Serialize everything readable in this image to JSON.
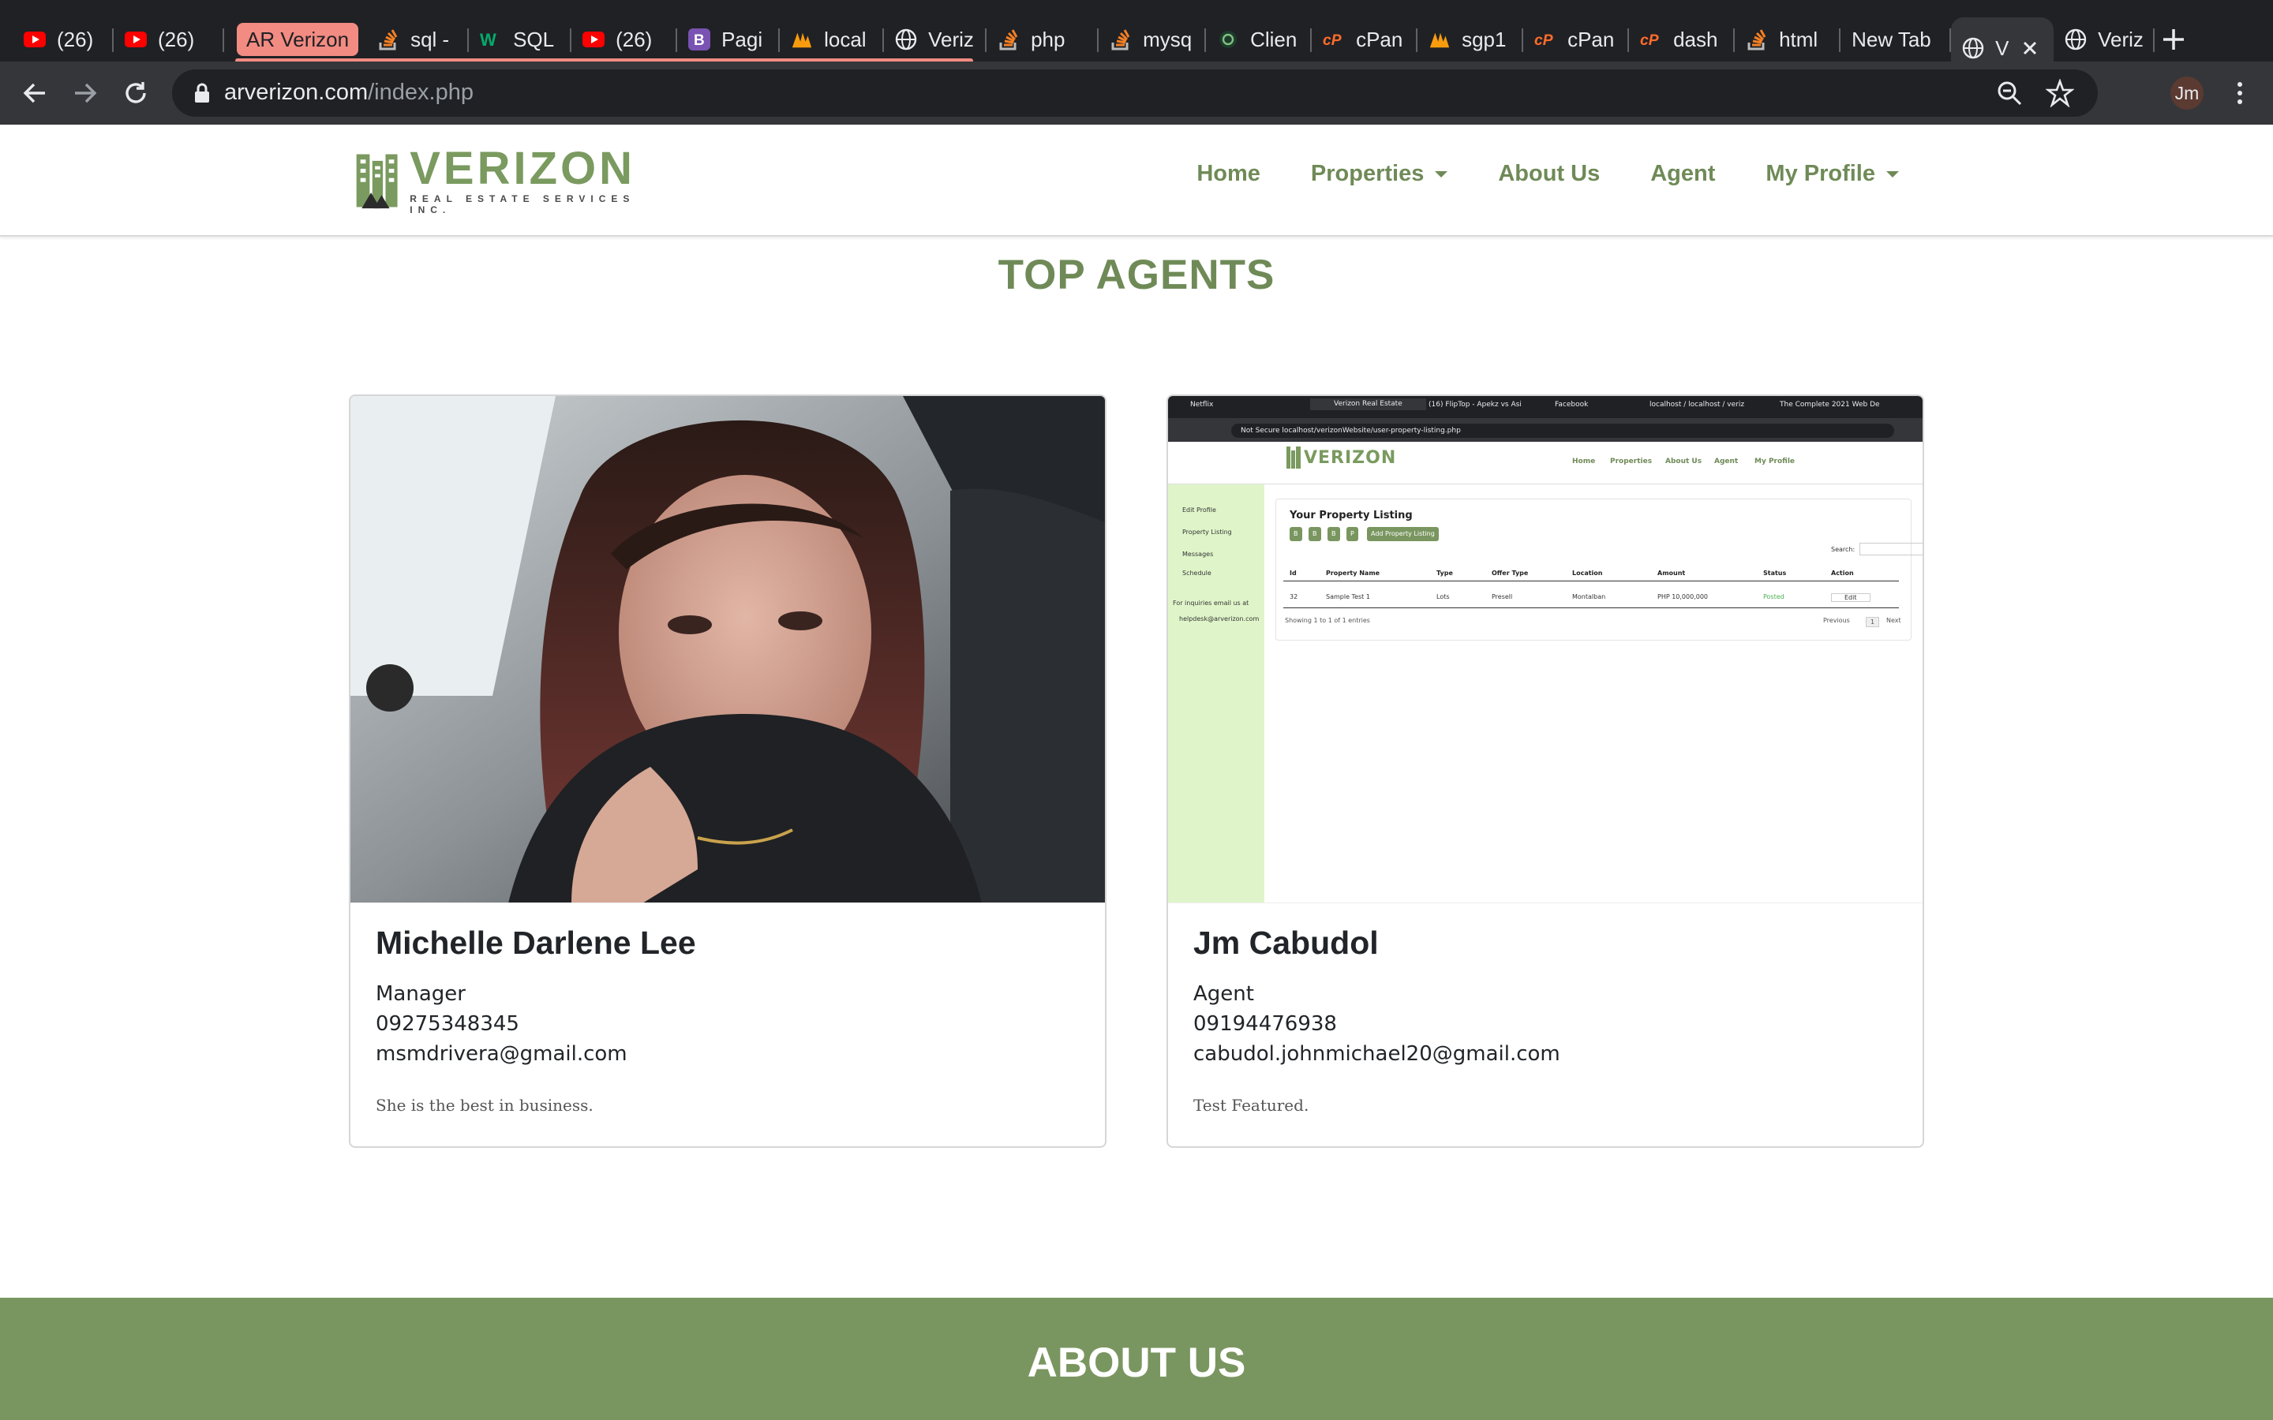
{
  "browser": {
    "tabs": [
      {
        "icon": "youtube-icon",
        "label": "(26)"
      },
      {
        "icon": "youtube-icon",
        "label": "(26)"
      },
      {
        "icon": "stackoverflow-icon",
        "label": "sql -"
      },
      {
        "icon": "w3schools-icon",
        "label": "SQL"
      },
      {
        "icon": "youtube-icon",
        "label": "(26)"
      },
      {
        "icon": "bootstrap-icon",
        "label": "Pagi"
      },
      {
        "icon": "phpmyadmin-icon",
        "label": "local"
      },
      {
        "icon": "globe-icon",
        "label": "Veriz"
      },
      {
        "icon": "stackoverflow-icon",
        "label": "php"
      },
      {
        "icon": "stackoverflow-icon",
        "label": "mysq"
      },
      {
        "icon": "client-icon",
        "label": "Clien"
      },
      {
        "icon": "cpanel-icon",
        "label": "cPan"
      },
      {
        "icon": "phpmyadmin-icon",
        "label": "sgp1"
      },
      {
        "icon": "cpanel-icon",
        "label": "cPan"
      },
      {
        "icon": "cpanel-icon",
        "label": "dash"
      },
      {
        "icon": "stackoverflow-icon",
        "label": "html"
      },
      {
        "icon": "",
        "label": "New Tab"
      },
      {
        "icon": "globe-icon",
        "label": "V"
      },
      {
        "icon": "globe-icon",
        "label": "Veriz"
      }
    ],
    "tab_group_label": "AR Verizon",
    "url_domain": "arverizon.com",
    "url_path": "/index.php",
    "profile_initials": "Jm",
    "colors": {
      "tab_group": "#f28b82",
      "chrome_dark": "#202124",
      "chrome_toolbar": "#35363a"
    }
  },
  "site": {
    "logo": {
      "word": "VERIZON",
      "sub": "REAL ESTATE SERVICES INC."
    },
    "nav": [
      {
        "label": "Home",
        "dropdown": false
      },
      {
        "label": "Properties",
        "dropdown": true
      },
      {
        "label": "About Us",
        "dropdown": false
      },
      {
        "label": "Agent",
        "dropdown": false
      },
      {
        "label": "My Profile",
        "dropdown": true
      }
    ],
    "colors": {
      "brand_green": "#6f8a57",
      "band_green": "#7a9660"
    }
  },
  "top_agents": {
    "title": "TOP AGENTS",
    "agents": [
      {
        "name": "Michelle Darlene Lee",
        "role": "Manager",
        "phone": "09275348345",
        "email": "msmdrivera@gmail.com",
        "description": "She is the best in business."
      },
      {
        "name": "Jm Cabudol",
        "role": "Agent",
        "phone": "09194476938",
        "email": "cabudol.johnmichael20@gmail.com",
        "description": "Test Featured."
      }
    ]
  },
  "about": {
    "title": "ABOUT US"
  },
  "agent2_screenshot": {
    "tabs": [
      "Netflix",
      "Verizon Real Estate",
      "(16) FlipTop - Apekz vs Asi",
      "Facebook",
      "localhost / localhost / veriz",
      "The Complete 2021 Web De"
    ],
    "url": "Not Secure  localhost/verizonWebsite/user-property-listing.php",
    "nav": [
      "Home",
      "Properties",
      "About Us",
      "Agent",
      "My Profile"
    ],
    "sidebar": [
      "Edit Profile",
      "Property Listing",
      "Messages",
      "Schedule"
    ],
    "inquiries": "For inquiries email us at",
    "inquiries_email": "helpdesk@arverizon.com",
    "panel_title": "Your Property Listing",
    "add_button": "Add Property Listing",
    "search_label": "Search:",
    "columns": [
      "Id",
      "Property Name",
      "Type",
      "Offer Type",
      "Location",
      "Amount",
      "Status",
      "Action"
    ],
    "row": [
      "32",
      "Sample Test 1",
      "Lots",
      "Presell",
      "Montalban",
      "PHP 10,000,000",
      "Posted",
      "Edit"
    ],
    "footer": "Showing 1 to 1 of 1 entries",
    "pager": [
      "Previous",
      "1",
      "Next"
    ]
  }
}
